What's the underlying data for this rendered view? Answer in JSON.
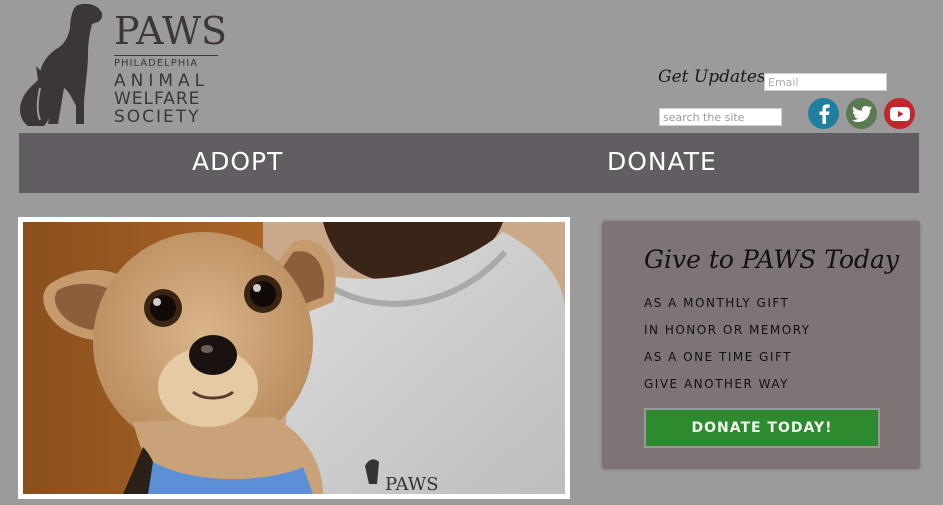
{
  "logo": {
    "brand": "PAWS",
    "line1": "Philadelphia",
    "line2": "Animal",
    "line3": "Welfare",
    "line4": "Society"
  },
  "header": {
    "updates_label": "Get Updates:",
    "email_placeholder": "Email",
    "search_placeholder": "search the site",
    "social": [
      {
        "name": "facebook",
        "icon": "facebook-icon",
        "color": "#1e7fa0"
      },
      {
        "name": "twitter",
        "icon": "twitter-icon",
        "color": "#5a7a52"
      },
      {
        "name": "youtube",
        "icon": "youtube-icon",
        "color": "#c0282d"
      }
    ]
  },
  "nav": {
    "items": [
      {
        "label": "ADOPT"
      },
      {
        "label": "DONATE"
      }
    ]
  },
  "give": {
    "title": "Give to PAWS Today",
    "links": [
      {
        "label": "AS A MONTHLY GIFT"
      },
      {
        "label": "IN HONOR OR MEMORY"
      },
      {
        "label": "AS A ONE TIME GIFT"
      },
      {
        "label": "GIVE ANOTHER WAY"
      }
    ],
    "button_label": "DONATE TODAY!",
    "button_color": "#2e8a2f"
  }
}
